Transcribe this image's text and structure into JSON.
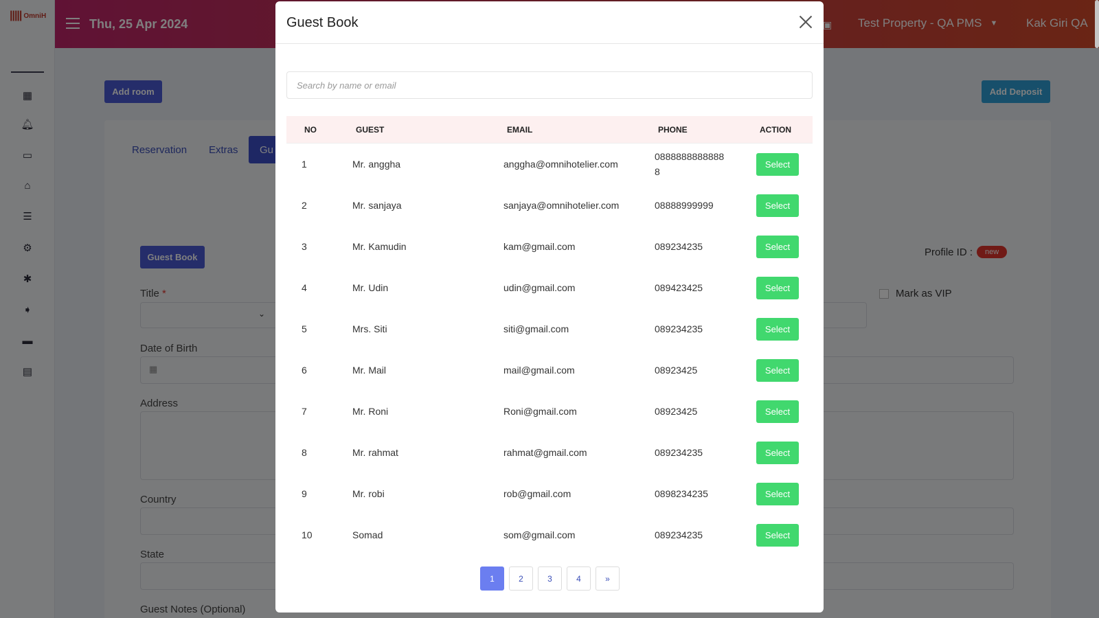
{
  "app": {
    "logo_text": "OmniH",
    "date": "Thu, 25 Apr 2024",
    "property": "Test Property - QA PMS",
    "user": "Kak Giri QA"
  },
  "sidebar": {
    "icons": [
      "dashboard-icon",
      "notification-icon",
      "folder-icon",
      "housekeeping-icon",
      "list-icon",
      "settings-icon",
      "integration-icon",
      "tag-icon",
      "laptop-icon",
      "report-icon"
    ]
  },
  "page": {
    "add_room": "Add room",
    "add_deposit": "Add Deposit",
    "tabs": [
      "Reservation",
      "Extras",
      "Gu"
    ],
    "guest_book_btn": "Guest Book",
    "profile_id_label": "Profile ID :",
    "profile_badge": "new",
    "mark_vip": "Mark as VIP",
    "labels": {
      "title": "Title",
      "title_required": "*",
      "dob": "Date of Birth",
      "address": "Address",
      "country": "Country",
      "state": "State",
      "notes": "Guest Notes (Optional)"
    }
  },
  "modal": {
    "title": "Guest Book",
    "search_placeholder": "Search by name or email",
    "columns": [
      "NO",
      "GUEST",
      "EMAIL",
      "PHONE",
      "ACTION"
    ],
    "select_label": "Select",
    "rows": [
      {
        "no": "1",
        "guest": "Mr. anggha",
        "email": "anggha@omnihotelier.com",
        "phone": "08888888888888"
      },
      {
        "no": "2",
        "guest": "Mr. sanjaya",
        "email": "sanjaya@omnihotelier.com",
        "phone": "08888999999"
      },
      {
        "no": "3",
        "guest": "Mr. Kamudin",
        "email": "kam@gmail.com",
        "phone": "089234235"
      },
      {
        "no": "4",
        "guest": "Mr. Udin",
        "email": "udin@gmail.com",
        "phone": "089423425"
      },
      {
        "no": "5",
        "guest": "Mrs. Siti",
        "email": "siti@gmail.com",
        "phone": "089234235"
      },
      {
        "no": "6",
        "guest": "Mr. Mail",
        "email": "mail@gmail.com",
        "phone": "08923425"
      },
      {
        "no": "7",
        "guest": "Mr. Roni",
        "email": "Roni@gmail.com",
        "phone": "08923425"
      },
      {
        "no": "8",
        "guest": "Mr. rahmat",
        "email": "rahmat@gmail.com",
        "phone": "089234235"
      },
      {
        "no": "9",
        "guest": "Mr. robi",
        "email": "rob@gmail.com",
        "phone": "0898234235"
      },
      {
        "no": "10",
        "guest": "Somad",
        "email": "som@gmail.com",
        "phone": "089234235"
      }
    ],
    "pagination": {
      "pages": [
        "1",
        "2",
        "3",
        "4"
      ],
      "next": "»",
      "active": "1"
    }
  },
  "colors": {
    "header_start": "#c0256a",
    "header_end": "#d44a2a",
    "primary": "#3b4fb8",
    "select_green": "#41d86e",
    "badge_red": "#e0342c"
  }
}
